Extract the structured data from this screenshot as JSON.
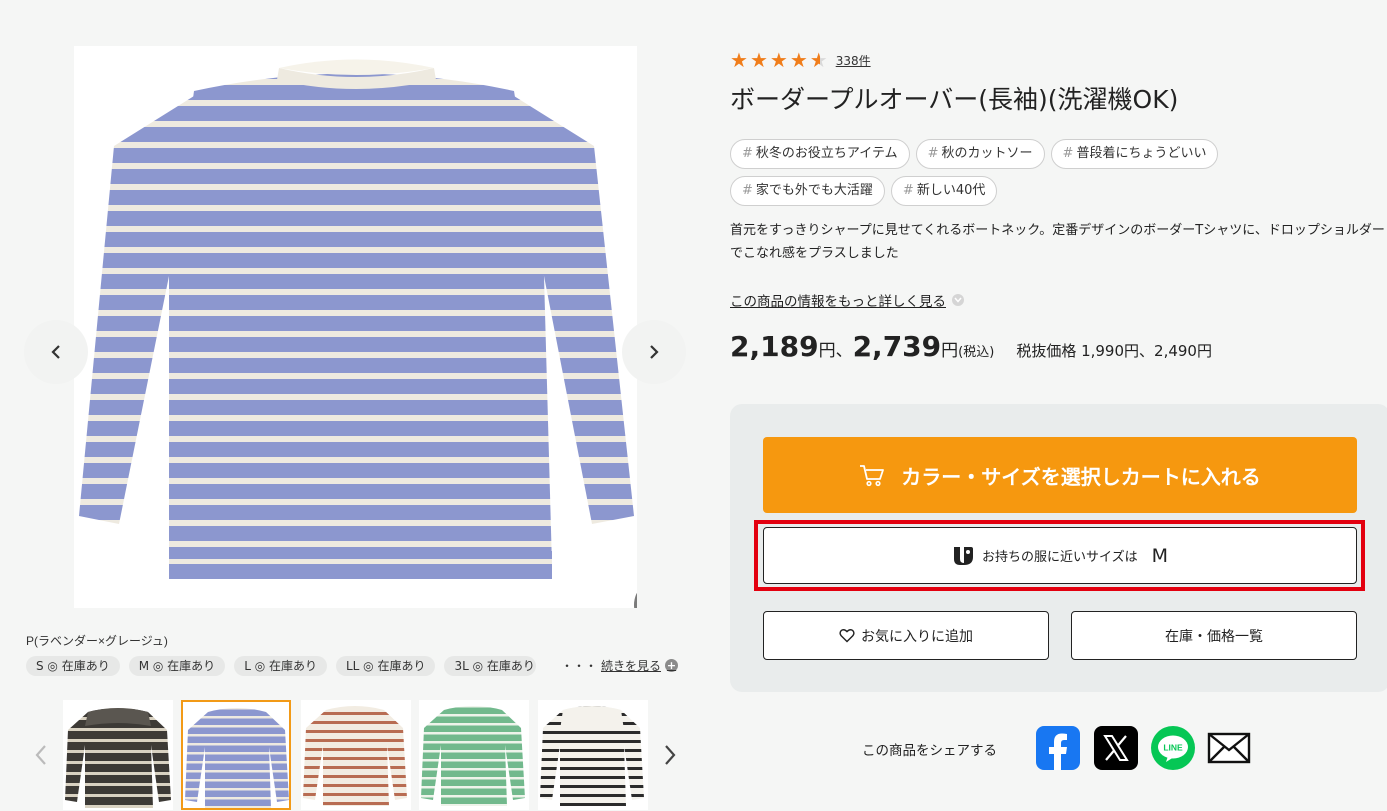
{
  "gallery": {
    "color_name": "P(ラベンダー×グレージュ)",
    "stock": [
      {
        "label": "S ◎ 在庫あり"
      },
      {
        "label": "M ◎ 在庫あり"
      },
      {
        "label": "L ◎ 在庫あり"
      },
      {
        "label": "LL ◎ 在庫あり"
      },
      {
        "label": "3L ◎ 在庫あり"
      }
    ],
    "ellipsis": "・・・",
    "see_more": "続きを見る",
    "plus": "+"
  },
  "product": {
    "rating": 4.5,
    "review_count": "338件",
    "title": "ボーダープルオーバー(長袖)(洗濯機OK)",
    "tags": [
      {
        "label": "秋冬のお役立ちアイテム"
      },
      {
        "label": "秋のカットソー"
      },
      {
        "label": "普段着にちょうどいい"
      },
      {
        "label": "家でも外でも大活躍"
      },
      {
        "label": "新しい40代"
      }
    ],
    "tag_hash": "#",
    "description": "首元をすっきりシャープに見せてくれるボートネック。定番デザインのボーダーTシャツに、ドロップショルダーでこなれ感をプラスしました",
    "more_info": "この商品の情報をもっと詳しく見る",
    "price": {
      "price1": "2,189",
      "yen": "円",
      "separator": "、",
      "price2": "2,739",
      "tax_in": "(税込)",
      "ex_tax": "税抜価格 1,990円、2,490円"
    }
  },
  "actions": {
    "cart": "カラー・サイズを選択しカートに入れる",
    "size_prefix": "お持ちの服に近いサイズは",
    "size_value": "M",
    "favorite": "お気に入りに追加",
    "stock_list": "在庫・価格一覧"
  },
  "share": {
    "label": "この商品をシェアする",
    "line_text": "LINE"
  },
  "colors": {
    "accent": "#f6980f",
    "star": "#f07d1a",
    "highlight": "#e3000f",
    "panel": "#e9ecec"
  }
}
